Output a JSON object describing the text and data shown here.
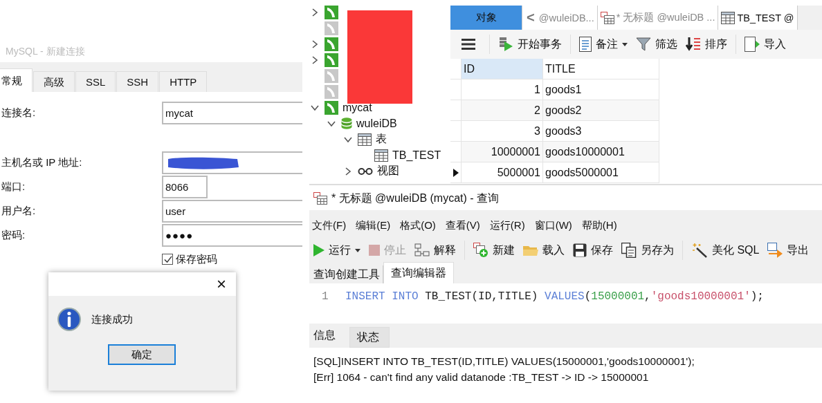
{
  "connection_dialog": {
    "title": "MySQL - 新建连接",
    "tabs": [
      {
        "label": "常规",
        "selected": true
      },
      {
        "label": "高级",
        "selected": false
      },
      {
        "label": "SSL",
        "selected": false
      },
      {
        "label": "SSH",
        "selected": false
      },
      {
        "label": "HTTP",
        "selected": false
      }
    ],
    "fields": [
      {
        "label": "连接名:",
        "value": "mycat",
        "kind": "text"
      },
      {
        "label": "主机名或 IP 地址:",
        "kind": "text",
        "redacted": true
      },
      {
        "label": "端口:",
        "value": "8066",
        "kind": "short"
      },
      {
        "label": "用户名:",
        "value": "user",
        "kind": "text"
      },
      {
        "label": "密码:",
        "value": "●●●●",
        "kind": "password"
      }
    ],
    "save_password": {
      "label": "保存密码",
      "checked": true
    }
  },
  "message_box": {
    "close": "×",
    "message": "连接成功",
    "button": "确定"
  },
  "navigator": {
    "redacted": true,
    "tree": [
      {
        "kind": "server",
        "connected": true,
        "expanded": false
      },
      {
        "kind": "server",
        "connected": false
      },
      {
        "kind": "server",
        "connected": true,
        "expanded": false
      },
      {
        "kind": "server",
        "connected": true,
        "expanded": false
      },
      {
        "kind": "server",
        "connected": false
      },
      {
        "kind": "server",
        "connected": false
      },
      {
        "kind": "server",
        "connected": true,
        "expanded": true,
        "label": "mycat",
        "children": [
          {
            "kind": "database",
            "expanded": true,
            "label": "wuleiDB",
            "children": [
              {
                "kind": "tables",
                "expanded": true,
                "label": "表",
                "children": [
                  {
                    "kind": "table",
                    "label": "TB_TEST"
                  }
                ]
              },
              {
                "kind": "views",
                "expanded": false,
                "label": "视图"
              }
            ]
          }
        ]
      }
    ]
  },
  "object_tabs": [
    {
      "label": "对象",
      "kind": "objects",
      "selected": true
    },
    {
      "label": "<",
      "kind": "scroll"
    },
    {
      "label": "@wuleiDB...",
      "kind": "plain",
      "selected": false
    },
    {
      "label": "* 无标题 @wuleiDB ...",
      "kind": "query",
      "selected": false
    },
    {
      "label": "TB_TEST @",
      "kind": "table",
      "selected": false
    }
  ],
  "object_toolbar": [
    {
      "kind": "menu"
    },
    {
      "kind": "transaction",
      "label": "开始事务"
    },
    {
      "kind": "note",
      "label": "备注",
      "dropdown": true
    },
    {
      "kind": "filter",
      "label": "筛选"
    },
    {
      "kind": "sort",
      "label": "排序"
    },
    {
      "kind": "import",
      "label": "导入"
    }
  ],
  "table": {
    "columns": [
      {
        "label": "ID",
        "selected": true
      },
      {
        "label": "TITLE",
        "selected": false
      }
    ],
    "rows": [
      {
        "cells": [
          "1",
          "goods1"
        ],
        "selected": false
      },
      {
        "cells": [
          "2",
          "goods2"
        ],
        "selected": false
      },
      {
        "cells": [
          "3",
          "goods3"
        ],
        "selected": false
      },
      {
        "cells": [
          "10000001",
          "goods10000001"
        ],
        "selected": false
      },
      {
        "cells": [
          "5000001",
          "goods5000001"
        ],
        "selected": true
      }
    ]
  },
  "query_window": {
    "title": "* 无标题 @wuleiDB (mycat) - 查询",
    "menu": [
      "文件(F)",
      "编辑(E)",
      "格式(O)",
      "查看(V)",
      "运行(R)",
      "窗口(W)",
      "帮助(H)"
    ],
    "toolbar": [
      {
        "kind": "run",
        "label": "运行",
        "dropdown": true,
        "disabled": false
      },
      {
        "kind": "stop",
        "label": "停止",
        "disabled": true
      },
      {
        "kind": "explain",
        "label": "解释",
        "disabled": false
      },
      {
        "kind": "new",
        "label": "新建",
        "disabled": false
      },
      {
        "kind": "load",
        "label": "载入",
        "disabled": false
      },
      {
        "kind": "save",
        "label": "保存",
        "disabled": false
      },
      {
        "kind": "saveas",
        "label": "另存为",
        "disabled": false
      },
      {
        "kind": "beautify",
        "label": "美化 SQL",
        "disabled": false
      },
      {
        "kind": "export",
        "label": "导出",
        "disabled": false
      }
    ],
    "tabs": [
      {
        "label": "查询创建工具",
        "selected": false
      },
      {
        "label": "查询编辑器",
        "selected": true
      }
    ],
    "editor": {
      "line_number": "1",
      "tokens": [
        {
          "text": "INSERT INTO",
          "kind": "keyword"
        },
        {
          "text": " TB_TEST(ID,TITLE) ",
          "kind": "plain"
        },
        {
          "text": "VALUES",
          "kind": "keyword"
        },
        {
          "text": "(",
          "kind": "plain"
        },
        {
          "text": "15000001",
          "kind": "number"
        },
        {
          "text": ",",
          "kind": "plain"
        },
        {
          "text": "'goods10000001'",
          "kind": "string"
        },
        {
          "text": ");",
          "kind": "plain"
        }
      ]
    },
    "result_tabs": [
      {
        "label": "信息",
        "selected": true
      },
      {
        "label": "状态",
        "selected": false
      }
    ],
    "messages": [
      "[SQL]INSERT INTO TB_TEST(ID,TITLE) VALUES(15000001,'goods10000001');",
      "[Err] 1064 - can't find any valid datanode :TB_TEST -> ID -> 15000001"
    ]
  }
}
